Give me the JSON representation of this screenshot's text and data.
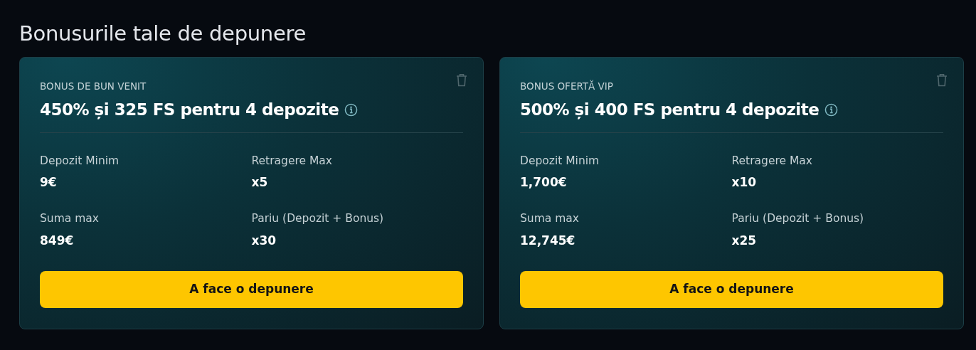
{
  "heading": "Bonusurile tale de depunere",
  "bonuses": [
    {
      "label": "BONUS DE BUN VENIT",
      "title": "450% și 325 FS pentru 4 depozite",
      "stats": [
        {
          "label": "Depozit Minim",
          "value": "9€"
        },
        {
          "label": "Retragere Max",
          "value": "x5"
        },
        {
          "label": "Suma max",
          "value": "849€"
        },
        {
          "label": "Pariu (Depozit + Bonus)",
          "value": "x30"
        }
      ],
      "button": "A face o depunere"
    },
    {
      "label": "BONUS OFERTĂ VIP",
      "title": "500% și 400 FS pentru 4 depozite",
      "stats": [
        {
          "label": "Depozit Minim",
          "value": "1,700€"
        },
        {
          "label": "Retragere Max",
          "value": "x10"
        },
        {
          "label": "Suma max",
          "value": "12,745€"
        },
        {
          "label": "Pariu (Depozit + Bonus)",
          "value": "x25"
        }
      ],
      "button": "A face o depunere"
    }
  ]
}
